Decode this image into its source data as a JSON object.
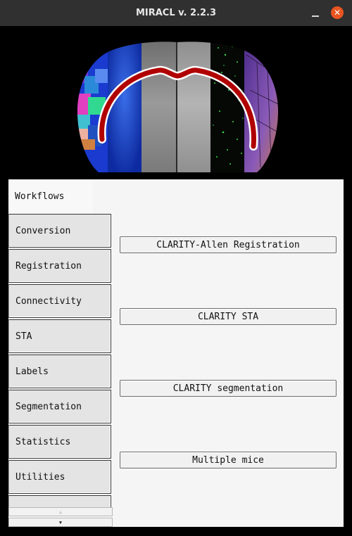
{
  "window": {
    "title": "MIRACL v. 2.2.3",
    "minimize_glyph": "",
    "close_glyph": "✕"
  },
  "banner": {
    "image": "brain-section-logo"
  },
  "tabs": [
    {
      "label": "Workflows",
      "active": true
    },
    {
      "label": "Conversion"
    },
    {
      "label": "Registration"
    },
    {
      "label": "Connectivity"
    },
    {
      "label": "STA"
    },
    {
      "label": "Labels"
    },
    {
      "label": "Segmentation"
    },
    {
      "label": "Statistics"
    },
    {
      "label": "Utilities"
    }
  ],
  "scroll": {
    "up_glyph": "▲",
    "down_glyph": "▼"
  },
  "buttons": [
    {
      "label": "CLARITY-Allen Registration"
    },
    {
      "label": "CLARITY STA"
    },
    {
      "label": "CLARITY segmentation"
    },
    {
      "label": "Multiple mice"
    }
  ],
  "colors": {
    "titlebar": "#303030",
    "close_button": "#e95420",
    "panel_background": "#f5f5f5",
    "tract_red": "#b00000"
  }
}
